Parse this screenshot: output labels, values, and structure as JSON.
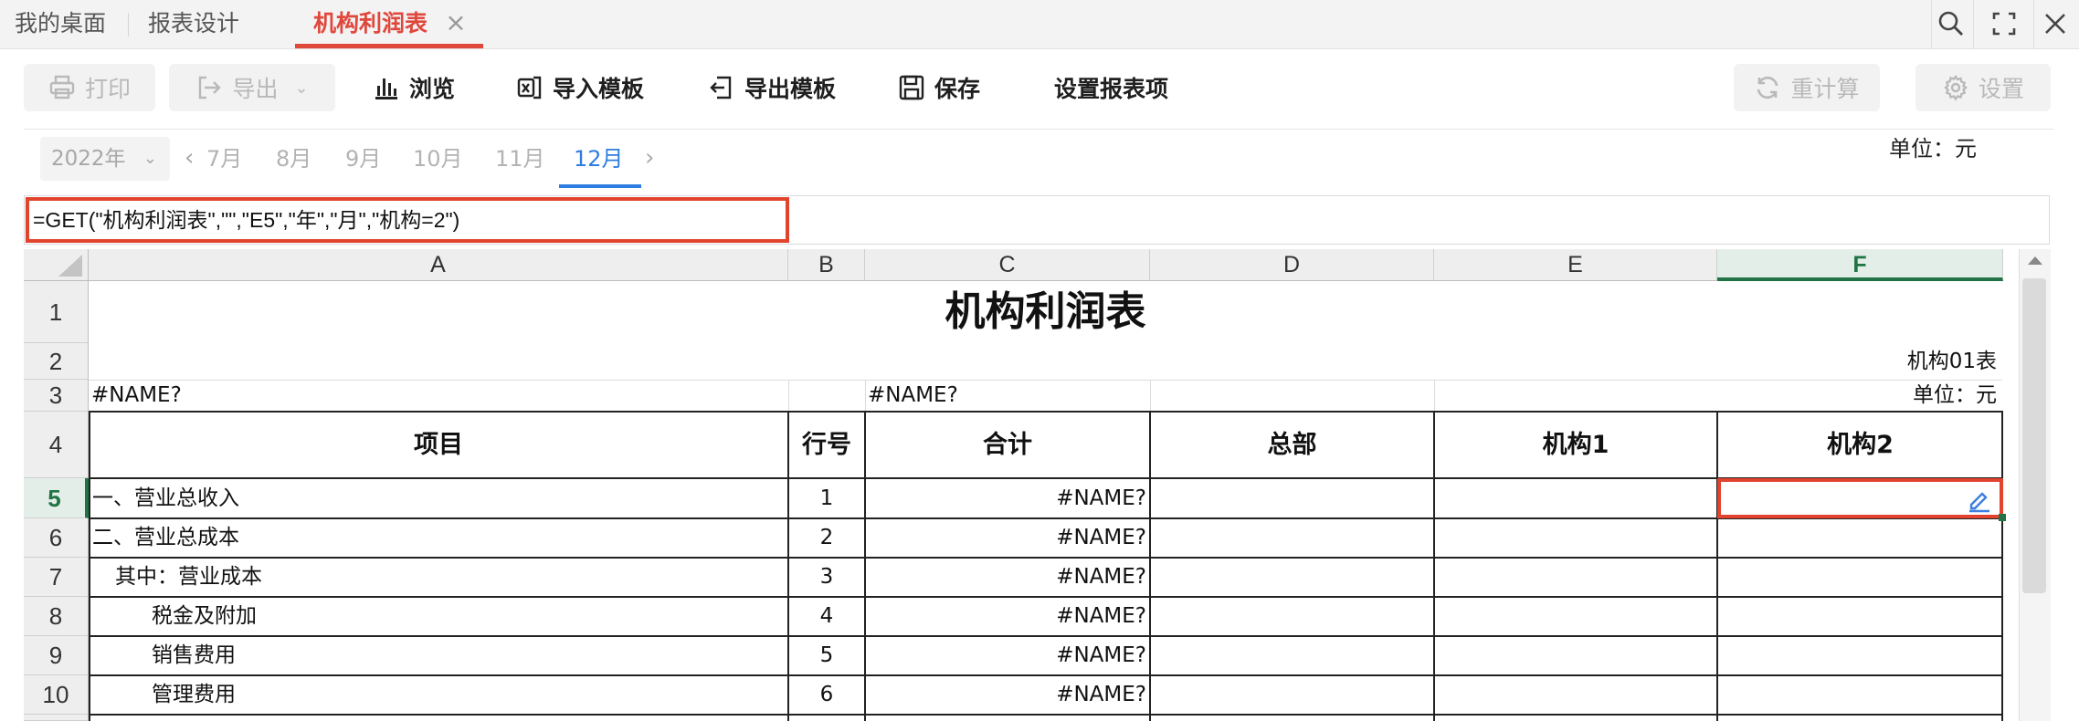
{
  "tabs": [
    {
      "label": "我的桌面",
      "active": false
    },
    {
      "label": "报表设计",
      "active": false
    },
    {
      "label": "机构利润表",
      "active": true
    }
  ],
  "window_controls": [
    "search-icon",
    "fullscreen-icon",
    "close-icon"
  ],
  "toolbar": {
    "print": "打印",
    "export": "导出",
    "browse": "浏览",
    "import_template": "导入模板",
    "export_template": "导出模板",
    "save": "保存",
    "set_items": "设置报表项",
    "recalculate": "重计算",
    "settings": "设置"
  },
  "period": {
    "year": "2022年",
    "months": [
      "7月",
      "8月",
      "9月",
      "10月",
      "11月",
      "12月"
    ],
    "active_month": "12月",
    "unit": "单位：元"
  },
  "formula": "=GET(\"机构利润表\",\"\",\"E5\",\"年\",\"月\",\"机构=2\")",
  "sheet": {
    "columns": [
      "A",
      "B",
      "C",
      "D",
      "E",
      "F"
    ],
    "selected_column": "F",
    "rows": [
      "1",
      "2",
      "3",
      "4",
      "5",
      "6",
      "7",
      "8",
      "9",
      "10"
    ],
    "selected_row": "5",
    "title": "机构利润表",
    "form_no": "机构01表",
    "unit": "单位：元",
    "row3_a": "#NAME?",
    "row3_c": "#NAME?",
    "headers": [
      "项目",
      "行号",
      "合计",
      "总部",
      "机构1",
      "机构2"
    ],
    "data_rows": [
      {
        "item": "一、营业总收入",
        "line": "1",
        "total": "#NAME?"
      },
      {
        "item": "二、营业总成本",
        "line": "2",
        "total": "#NAME?"
      },
      {
        "item": "其中：营业成本",
        "line": "3",
        "total": "#NAME?"
      },
      {
        "item": "税金及附加",
        "line": "4",
        "total": "#NAME?"
      },
      {
        "item": "销售费用",
        "line": "5",
        "total": "#NAME?"
      },
      {
        "item": "管理费用",
        "line": "6",
        "total": "#NAME?"
      }
    ]
  },
  "colors": {
    "accent_red": "#e0483c",
    "accent_blue": "#2f7de1",
    "excel_green": "#217346"
  }
}
